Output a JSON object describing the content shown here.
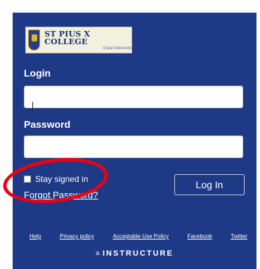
{
  "logo": {
    "name": "ST PIUS X COLLEGE",
    "location": "CHATSWOOD"
  },
  "login": {
    "label": "Login",
    "value": ""
  },
  "password": {
    "label": "Password",
    "value": ""
  },
  "stay_signed_in": {
    "label": "Stay signed in",
    "checked": false
  },
  "forgot_password": "Forgot Password?",
  "login_button": "Log In",
  "footer_links": [
    "Help",
    "Privacy policy",
    "Acceptable Use Policy",
    "Facebook",
    "Twitter"
  ],
  "brand": {
    "icon": "instructure-icon",
    "text": "INSTRUCTURE"
  },
  "colors": {
    "panel": "#1e3a86",
    "annotation": "#f00010"
  }
}
